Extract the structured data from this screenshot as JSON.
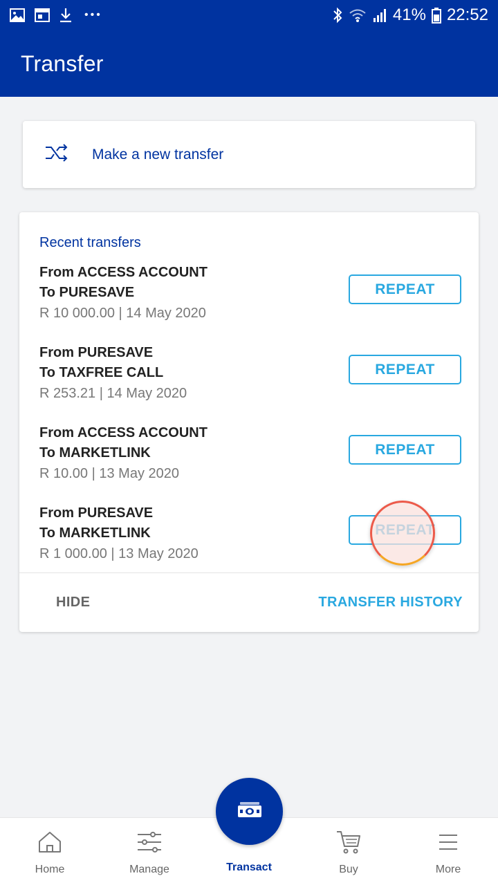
{
  "status_bar": {
    "battery_percent": "41%",
    "time": "22:52",
    "overflow_dots": "•••"
  },
  "app_bar": {
    "title": "Transfer"
  },
  "new_transfer": {
    "label": "Make a new transfer"
  },
  "recent": {
    "title": "Recent transfers",
    "items": [
      {
        "from": "From ACCESS ACCOUNT",
        "to": "To PURESAVE",
        "meta": "R 10 000.00 | 14 May 2020",
        "button": "REPEAT"
      },
      {
        "from": "From PURESAVE",
        "to": "To TAXFREE CALL",
        "meta": "R 253.21 | 14 May 2020",
        "button": "REPEAT"
      },
      {
        "from": "From ACCESS ACCOUNT",
        "to": "To MARKETLINK",
        "meta": "R 10.00 | 13 May 2020",
        "button": "REPEAT"
      },
      {
        "from": "From PURESAVE",
        "to": "To MARKETLINK",
        "meta": "R 1 000.00 | 13 May 2020",
        "button": "REPEAT"
      }
    ],
    "hide_label": "HIDE",
    "history_label": "TRANSFER HISTORY"
  },
  "bottom_nav": {
    "items": [
      {
        "label": "Home",
        "icon": "home-icon"
      },
      {
        "label": "Manage",
        "icon": "sliders-icon"
      },
      {
        "label": "Transact",
        "icon": "cash-icon",
        "active": true
      },
      {
        "label": "Buy",
        "icon": "cart-icon"
      },
      {
        "label": "More",
        "icon": "menu-icon"
      }
    ]
  },
  "colors": {
    "brand_blue": "#0033a0",
    "accent_cyan": "#29a8e0",
    "background": "#f2f3f5"
  }
}
